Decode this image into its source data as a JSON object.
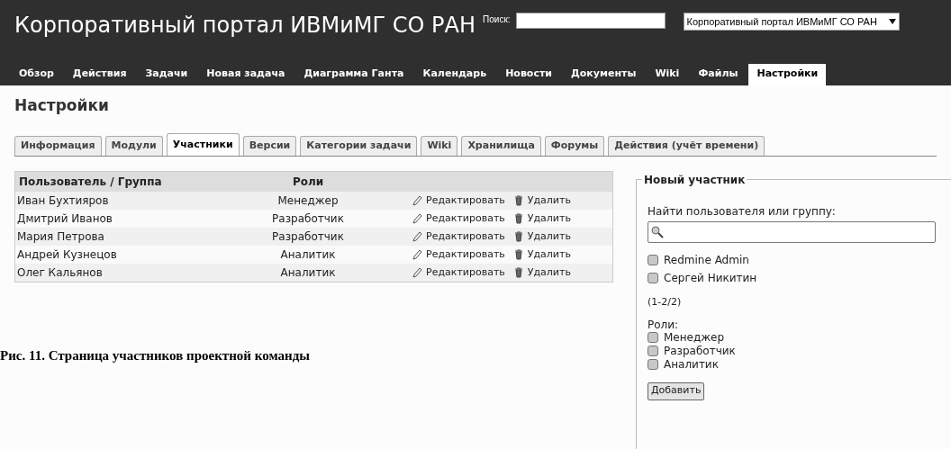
{
  "header": {
    "title": "Корпоративный портал ИВМиМГ СО РАН",
    "search_label": "Поиск:",
    "project_select": "Корпоративный портал ИВМиМГ СО РАН"
  },
  "main_menu": [
    {
      "label": "Обзор",
      "selected": false
    },
    {
      "label": "Действия",
      "selected": false
    },
    {
      "label": "Задачи",
      "selected": false
    },
    {
      "label": "Новая задача",
      "selected": false
    },
    {
      "label": "Диаграмма Ганта",
      "selected": false
    },
    {
      "label": "Календарь",
      "selected": false
    },
    {
      "label": "Новости",
      "selected": false
    },
    {
      "label": "Документы",
      "selected": false
    },
    {
      "label": "Wiki",
      "selected": false
    },
    {
      "label": "Файлы",
      "selected": false
    },
    {
      "label": "Настройки",
      "selected": true
    }
  ],
  "page_title": "Настройки",
  "tabs": [
    {
      "label": "Информация",
      "selected": false
    },
    {
      "label": "Модули",
      "selected": false
    },
    {
      "label": "Участники",
      "selected": true
    },
    {
      "label": "Версии",
      "selected": false
    },
    {
      "label": "Категории задачи",
      "selected": false
    },
    {
      "label": "Wiki",
      "selected": false
    },
    {
      "label": "Хранилища",
      "selected": false
    },
    {
      "label": "Форумы",
      "selected": false
    },
    {
      "label": "Действия (учёт времени)",
      "selected": false
    }
  ],
  "table": {
    "columns": [
      "Пользователь / Группа",
      "Роли"
    ],
    "rows": [
      {
        "user": "Иван Бухтияров",
        "role": "Менеджер",
        "edit": "Редактировать",
        "delete": "Удалить"
      },
      {
        "user": "Дмитрий Иванов",
        "role": "Разработчик",
        "edit": "Редактировать",
        "delete": "Удалить"
      },
      {
        "user": "Мария Петрова",
        "role": "Разработчик",
        "edit": "Редактировать",
        "delete": "Удалить"
      },
      {
        "user": "Андрей Кузнецов",
        "role": "Аналитик",
        "edit": "Редактировать",
        "delete": "Удалить"
      },
      {
        "user": "Олег Кальянов",
        "role": "Аналитик",
        "edit": "Редактировать",
        "delete": "Удалить"
      }
    ]
  },
  "new_member": {
    "legend": "Новый участник",
    "search_label": "Найти пользователя или группу:",
    "users": [
      {
        "label": "Redmine Admin",
        "checked": false
      },
      {
        "label": "Сергей Никитин",
        "checked": false
      }
    ],
    "pagination": "(1-2/2)",
    "roles_label": "Роли:",
    "roles": [
      {
        "label": "Менеджер",
        "checked": false
      },
      {
        "label": "Разработчик",
        "checked": false
      },
      {
        "label": "Аналитик",
        "checked": false
      }
    ],
    "add_button": "Добавить"
  },
  "caption": "Рис. 11. Страница участников проектной команды"
}
